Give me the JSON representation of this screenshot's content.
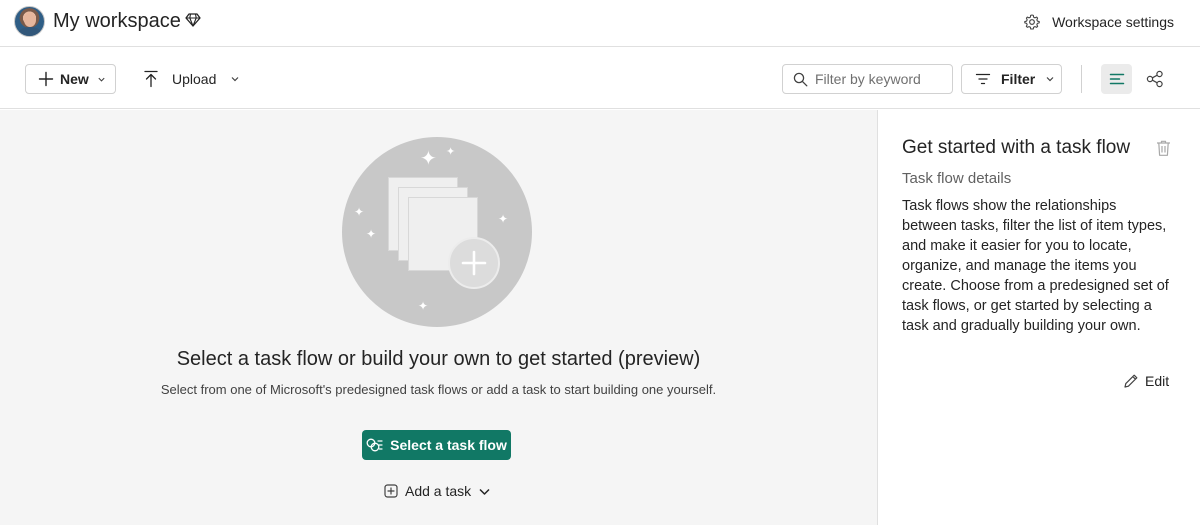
{
  "header": {
    "workspace_title": "My workspace",
    "settings_label": "Workspace settings"
  },
  "toolbar": {
    "new_label": "New",
    "upload_label": "Upload",
    "search_placeholder": "Filter by keyword",
    "filter_label": "Filter"
  },
  "canvas": {
    "title": "Select a task flow or build your own to get started (preview)",
    "subtitle": "Select from one of Microsoft's predesigned task flows or add a task to start building one yourself.",
    "select_flow_label": "Select a task flow",
    "add_task_label": "Add a task"
  },
  "panel": {
    "title": "Get started with a task flow",
    "subtitle": "Task flow details",
    "description": "Task flows show the relationships between tasks, filter the list of item types, and make it easier for you to locate, organize, and manage the items you create. Choose from a predesigned set of task flows, or get started by selecting a task and gradually building your own.",
    "edit_label": "Edit"
  },
  "colors": {
    "primary_button": "#117865",
    "canvas_background": "#f5f5f5",
    "active_view_background": "#ebebeb"
  },
  "icons": {
    "premium": "diamond-icon",
    "settings": "gear-icon",
    "new": "plus-icon",
    "upload": "upload-arrow-icon",
    "search": "search-icon",
    "filter": "filter-lines-icon",
    "list_view": "list-view-icon",
    "flow_view": "task-flow-view-icon",
    "delete": "trash-icon",
    "edit": "pencil-icon"
  }
}
